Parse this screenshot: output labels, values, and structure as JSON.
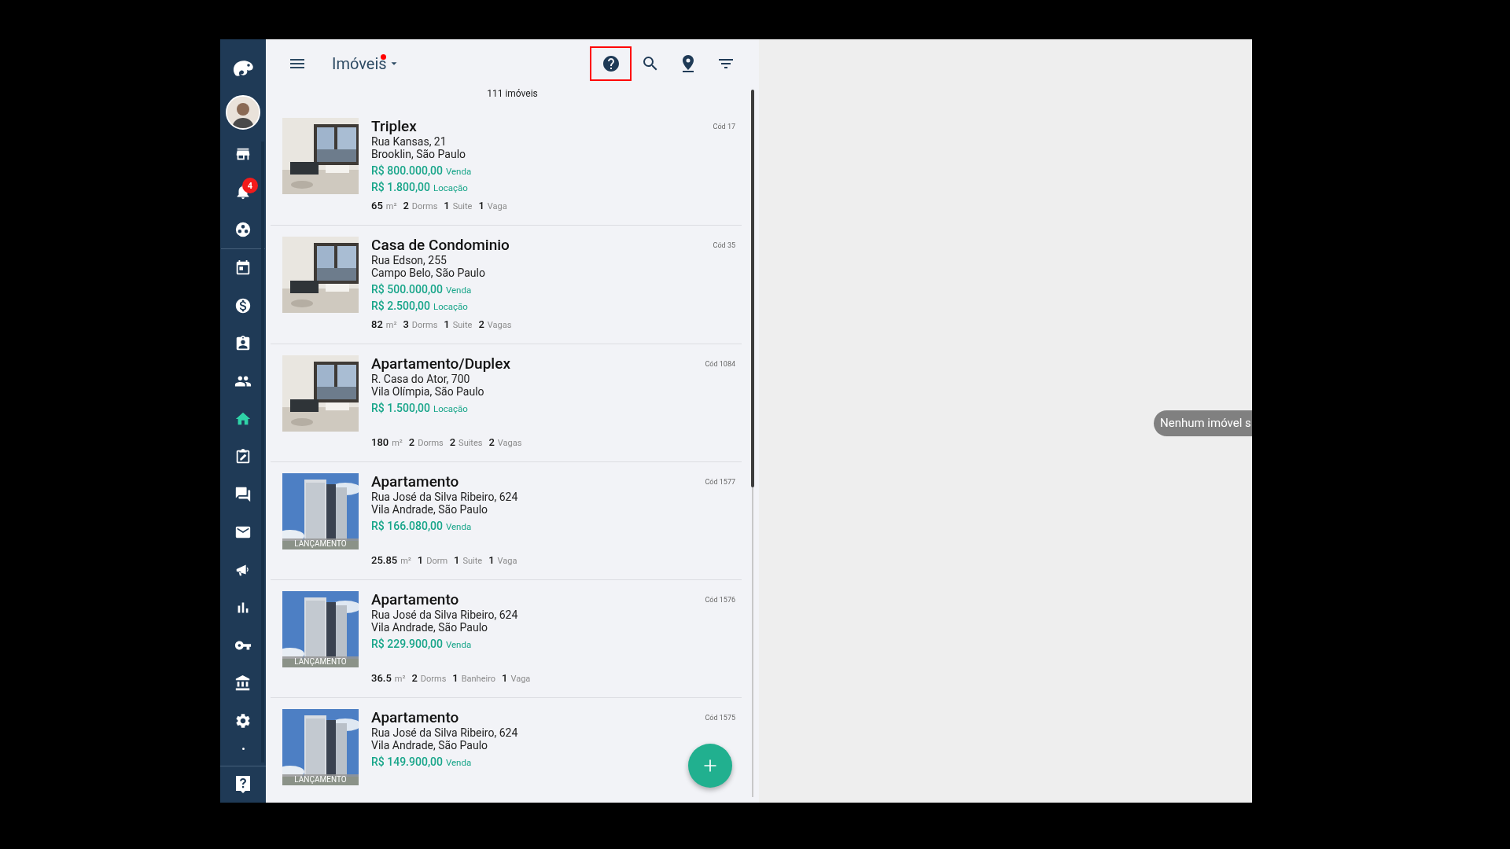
{
  "sidebar": {
    "items": [
      {
        "kind": "logo"
      },
      {
        "kind": "avatar"
      },
      {
        "kind": "store",
        "selected": false
      },
      {
        "kind": "bell",
        "selected": false,
        "badge": "4"
      },
      {
        "kind": "dots"
      },
      {
        "kind": "divider"
      },
      {
        "kind": "calendar",
        "selected": false
      },
      {
        "kind": "dollar",
        "selected": false
      },
      {
        "kind": "contact",
        "selected": false
      },
      {
        "kind": "people",
        "selected": false
      },
      {
        "kind": "home",
        "selected": true
      },
      {
        "kind": "edit",
        "selected": false
      },
      {
        "kind": "chat",
        "selected": false
      },
      {
        "kind": "mail",
        "selected": false
      },
      {
        "kind": "megaphone",
        "selected": false
      },
      {
        "kind": "chart",
        "selected": false
      },
      {
        "kind": "key",
        "selected": false
      },
      {
        "kind": "bank",
        "selected": false
      },
      {
        "kind": "gear",
        "selected": false
      },
      {
        "kind": "more"
      }
    ],
    "footer": {
      "kind": "help"
    }
  },
  "header": {
    "title": "Imóveis",
    "unread_dot": true,
    "toolbar": [
      {
        "kind": "help",
        "highlighted": true
      },
      {
        "kind": "search",
        "highlighted": false
      },
      {
        "kind": "pin",
        "highlighted": false
      },
      {
        "kind": "filter",
        "highlighted": false
      }
    ]
  },
  "count": "111 imóveis",
  "listings": [
    {
      "title": "Triplex",
      "code": "Cód 17",
      "address": "Rua Kansas, 21",
      "district": "Brooklin, São Paulo",
      "prices": [
        {
          "amount": "R$ 800.000,00",
          "label": "Venda"
        },
        {
          "amount": "R$ 1.800,00",
          "label": "Locação"
        }
      ],
      "features": [
        {
          "value": "65",
          "unit": "m²"
        },
        {
          "value": "2",
          "unit": "Dorms"
        },
        {
          "value": "1",
          "unit": "Suite"
        },
        {
          "value": "1",
          "unit": "Vaga"
        }
      ]
    },
    {
      "title": "Casa de Condominio",
      "code": "Cód 35",
      "address": "Rua Edson, 255",
      "district": "Campo Belo, São Paulo",
      "prices": [
        {
          "amount": "R$ 500.000,00",
          "label": "Venda"
        },
        {
          "amount": "R$ 2.500,00",
          "label": "Locação"
        }
      ],
      "features": [
        {
          "value": "82",
          "unit": "m²"
        },
        {
          "value": "3",
          "unit": "Dorms"
        },
        {
          "value": "1",
          "unit": "Suite"
        },
        {
          "value": "2",
          "unit": "Vagas"
        }
      ]
    },
    {
      "title": "Apartamento/Duplex",
      "code": "Cód 1084",
      "address": "R. Casa do Ator, 700",
      "district": "Vila Olímpia, São Paulo",
      "prices": [
        {
          "amount": "R$ 1.500,00",
          "label": "Locação"
        }
      ],
      "features": [
        {
          "value": "180",
          "unit": "m²"
        },
        {
          "value": "2",
          "unit": "Dorms"
        },
        {
          "value": "2",
          "unit": "Suites"
        },
        {
          "value": "2",
          "unit": "Vagas"
        }
      ]
    },
    {
      "title": "Apartamento",
      "code": "Cód 1577",
      "address": "Rua José da Silva Ribeiro, 624",
      "district": "Vila Andrade, São Paulo",
      "tag": "LANÇAMENTO",
      "prices": [
        {
          "amount": "R$ 166.080,00",
          "label": "Venda"
        }
      ],
      "features": [
        {
          "value": "25.85",
          "unit": "m²"
        },
        {
          "value": "1",
          "unit": "Dorm"
        },
        {
          "value": "1",
          "unit": "Suite"
        },
        {
          "value": "1",
          "unit": "Vaga"
        }
      ]
    },
    {
      "title": "Apartamento",
      "code": "Cód 1576",
      "address": "Rua José da Silva Ribeiro, 624",
      "district": "Vila Andrade, São Paulo",
      "tag": "LANÇAMENTO",
      "prices": [
        {
          "amount": "R$ 229.900,00",
          "label": "Venda"
        }
      ],
      "features": [
        {
          "value": "36.5",
          "unit": "m²"
        },
        {
          "value": "2",
          "unit": "Dorms"
        },
        {
          "value": "1",
          "unit": "Banheiro"
        },
        {
          "value": "1",
          "unit": "Vaga"
        }
      ]
    },
    {
      "title": "Apartamento",
      "code": "Cód 1575",
      "address": "Rua José da Silva Ribeiro, 624",
      "district": "Vila Andrade, São Paulo",
      "tag": "LANÇAMENTO",
      "prices": [
        {
          "amount": "R$ 149.900,00",
          "label": "Venda"
        }
      ]
    }
  ],
  "map": {
    "toast": "Nenhum imóvel s"
  }
}
